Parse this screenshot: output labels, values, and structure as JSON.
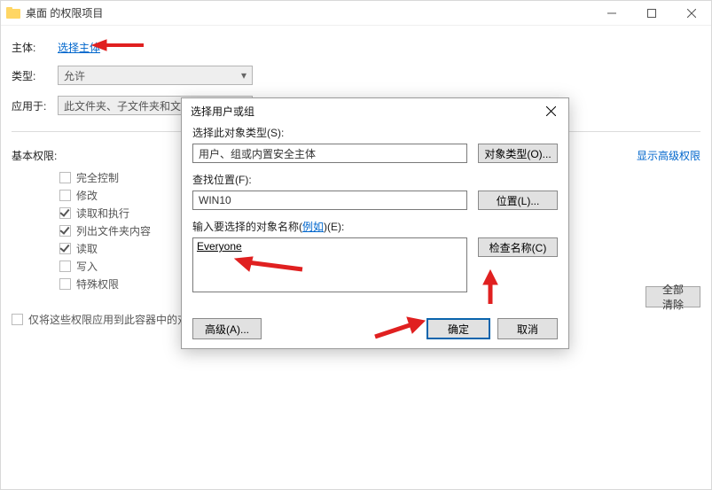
{
  "parent_window": {
    "title": "桌面 的权限项目",
    "sysbuttons": {
      "min": "minimize",
      "max": "maximize",
      "close": "close"
    },
    "form": {
      "principal_label": "主体:",
      "principal_link": "选择主体",
      "type_label": "类型:",
      "type_value": "允许",
      "applies_label": "应用于:",
      "applies_value": "此文件夹、子文件夹和文件"
    },
    "basic": {
      "heading": "基本权限:",
      "show_advanced": "显示高级权限",
      "perms": [
        {
          "label": "完全控制",
          "checked": false
        },
        {
          "label": "修改",
          "checked": false
        },
        {
          "label": "读取和执行",
          "checked": true
        },
        {
          "label": "列出文件夹内容",
          "checked": true
        },
        {
          "label": "读取",
          "checked": true
        },
        {
          "label": "写入",
          "checked": false
        },
        {
          "label": "特殊权限",
          "checked": false
        }
      ],
      "only_apply": "仅将这些权限应用到此容器中的对象和",
      "clear_all": "全部清除"
    }
  },
  "dialog": {
    "title": "选择用户或组",
    "object_type_label": "选择此对象类型(S):",
    "object_type_value": "用户、组或内置安全主体",
    "object_type_btn": "对象类型(O)...",
    "location_label": "查找位置(F):",
    "location_value": "WIN10",
    "location_btn": "位置(L)...",
    "name_label_pre": "输入要选择的对象名称(",
    "name_label_link": "例如",
    "name_label_post": ")(E):",
    "name_value": "Everyone",
    "check_names_btn": "检查名称(C)",
    "advanced_btn": "高级(A)...",
    "ok_btn": "确定",
    "cancel_btn": "取消"
  }
}
